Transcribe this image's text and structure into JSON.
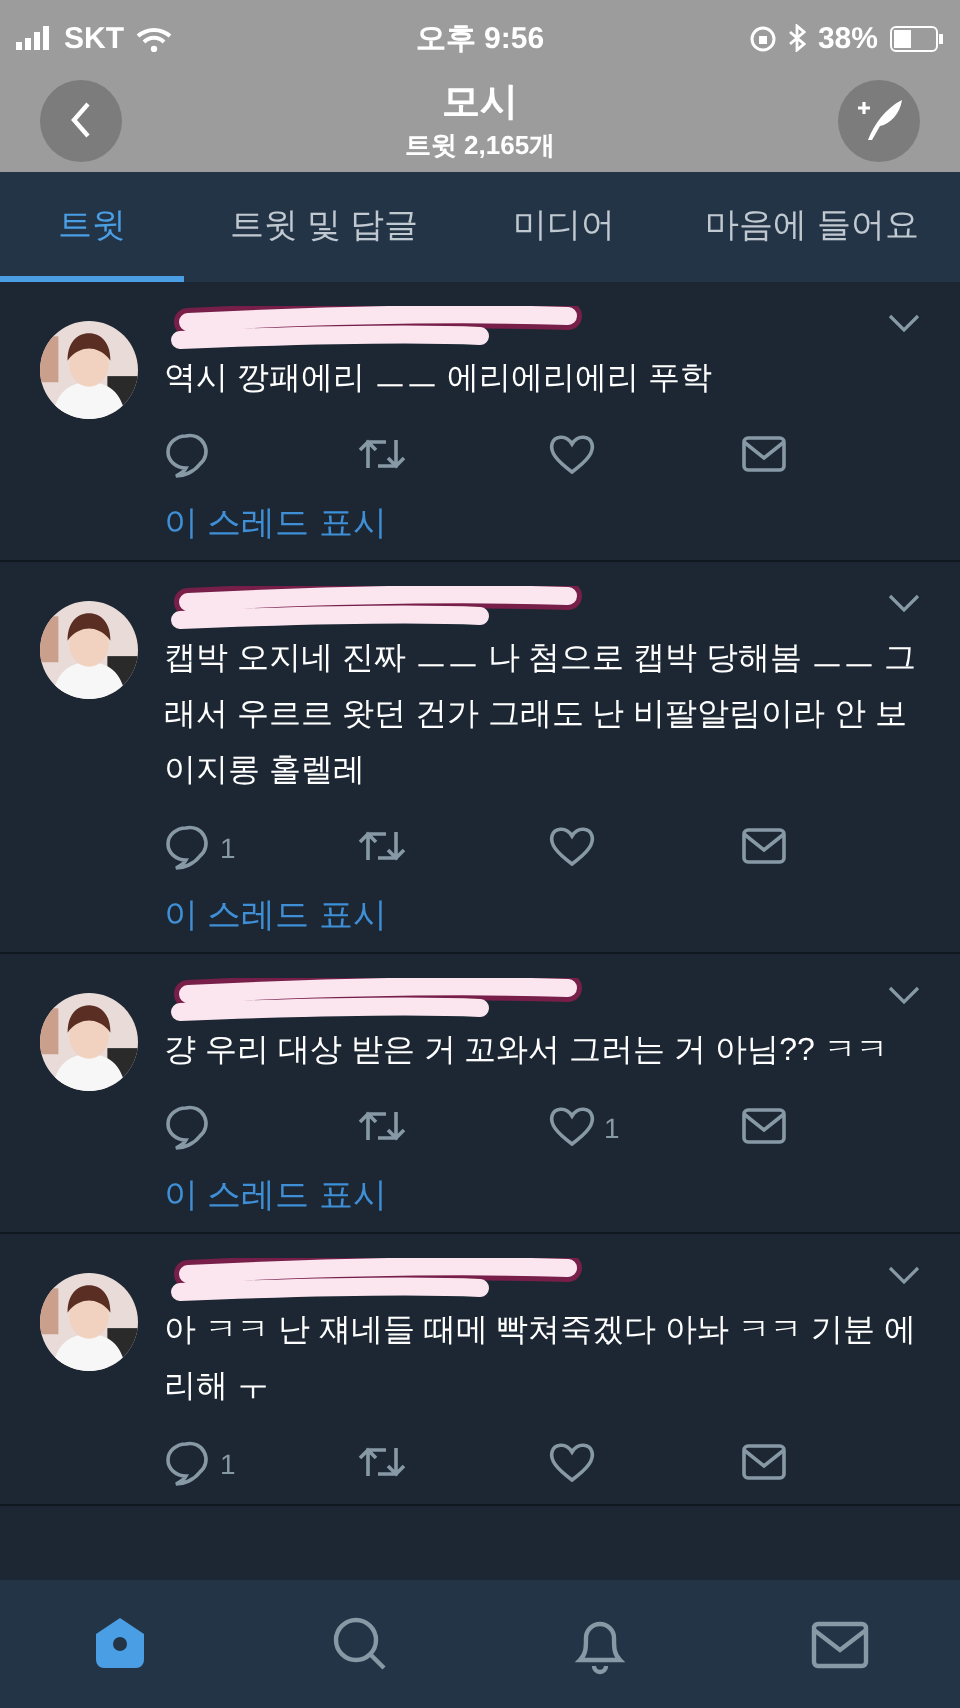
{
  "status_bar": {
    "carrier": "SKT",
    "time": "오후 9:56",
    "battery": "38%"
  },
  "header": {
    "title": "모시",
    "subtitle": "트윗 2,165개"
  },
  "tabs": [
    {
      "label": "트윗",
      "selected": true
    },
    {
      "label": "트윗 및 답글",
      "selected": false
    },
    {
      "label": "미디어",
      "selected": false
    },
    {
      "label": "마음에 들어요",
      "selected": false
    }
  ],
  "tweets": [
    {
      "text": "역시 깡패에리 ㅡㅡ 에리에리에리 푸학",
      "thread_link": "이 스레드 표시"
    },
    {
      "text": "캡박 오지네 진짜 ㅡㅡ 나 첨으로 캡박 당해봄 ㅡㅡ 그래서 우르르 왓던 건가 그래도 난 비팔알림이라 안 보이지롱 홀렐레",
      "reply_count": "1",
      "thread_link": "이 스레드 표시"
    },
    {
      "text": "걍 우리 대상 받은 거 꼬와서 그러는 거 아님?? ㅋㅋ",
      "like_count": "1",
      "thread_link": "이 스레드 표시"
    },
    {
      "text": "아 ㅋㅋ 난 쟤네들 때메 빡쳐죽겠다 아놔 ㅋㅋ 기분 에리해 ㅜ",
      "reply_count": "1"
    }
  ],
  "tab_bar": [
    {
      "kind": "home",
      "selected": true
    },
    {
      "kind": "search",
      "selected": false
    },
    {
      "kind": "notifications",
      "selected": false
    },
    {
      "kind": "messages",
      "selected": false
    }
  ]
}
